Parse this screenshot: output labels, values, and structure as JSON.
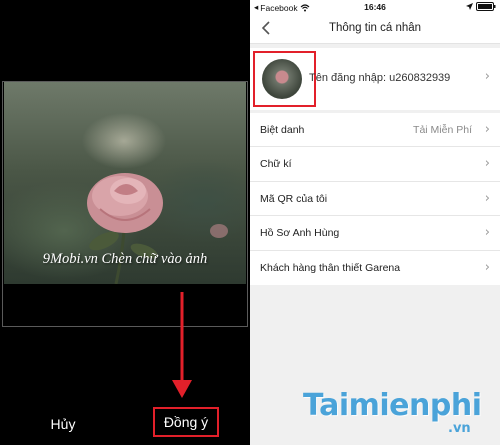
{
  "left_screen": {
    "photo_caption": "9Mobi.vn Chèn chữ vào ảnh",
    "cancel_label": "Hủy",
    "agree_label": "Đồng ý"
  },
  "right_screen": {
    "status_bar": {
      "back_app_label": "Facebook",
      "time": "16:46"
    },
    "nav_title": "Thông tin cá nhân",
    "profile": {
      "username_label": "Tên đăng nhập: u260832939"
    },
    "menu_items": [
      {
        "label": "Biệt danh",
        "value": "Tải Miễn Phí"
      },
      {
        "label": "Chữ kí"
      },
      {
        "label": "Mã QR của tôi"
      },
      {
        "label": "Hồ Sơ Anh Hùng"
      },
      {
        "label": "Khách hàng thân thiết Garena"
      }
    ]
  },
  "watermark": {
    "brand": "Taimienphi",
    "tld": ".vn"
  },
  "colors": {
    "highlight_red": "#e2202a",
    "brand_blue": "#4aa3d9"
  },
  "icons": [
    "chevron-left-icon",
    "chevron-right-icon",
    "signal-icon",
    "wifi-icon",
    "battery-icon",
    "arrow-down-icon"
  ]
}
